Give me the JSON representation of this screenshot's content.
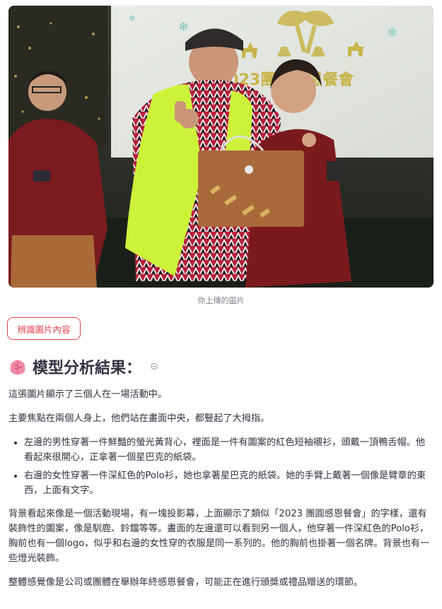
{
  "photo": {
    "banner_text": "2023團圓感恩餐會",
    "description_icon": "event-photo"
  },
  "caption": "你上傳的圖片",
  "recognize_button": "辨識圖片內容",
  "heading": {
    "icon": "brain-icon",
    "text": "模型分析結果：",
    "link_icon": "link-icon"
  },
  "analysis": {
    "p1": "這張圖片顯示了三個人在一場活動中。",
    "p2": "主要焦點在兩個人身上，他們站在畫面中央，都豎起了大拇指。",
    "bullets": [
      "左邊的男性穿著一件鮮豔的螢光黃背心，裡面是一件有圖案的紅色短袖襯衫，頭戴一頂鴨舌帽。他看起來很開心，正拿著一個星巴克的紙袋。",
      "右邊的女性穿著一件深紅色的Polo衫，她也拿著星巴克的紙袋。她的手臂上戴著一個像是臂章的東西，上面有文字。"
    ],
    "p3": "背景看起來像是一個活動現場，有一塊投影幕，上面顯示了類似「2023 團圓感恩餐會」的字樣，還有裝飾性的圖案，像是馴鹿、鈴鐺等等。畫面的左邊還可以看到另一個人，他穿著一件深紅色的Polo衫，胸前也有一個logo，似乎和右邊的女性穿的衣服是同一系列的。他的胸前也掛著一個名牌。背景也有一些燈光裝飾。",
    "p4": "整體感覺像是公司或團體在舉辦年終感恩餐會，可能正在進行頒獎或禮品贈送的環節。"
  },
  "colors": {
    "accent": "#e3434a",
    "text": "#31333f",
    "muted": "#7b7f87"
  }
}
